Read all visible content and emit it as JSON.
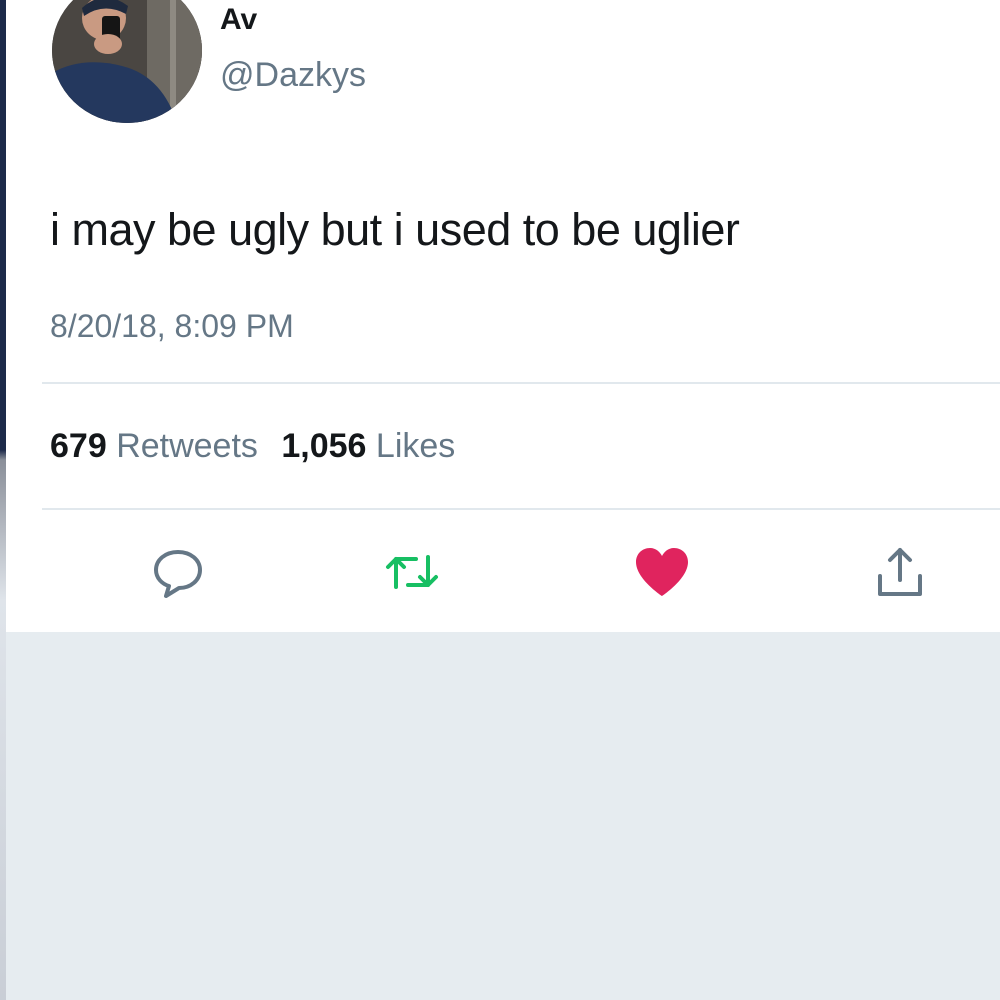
{
  "tweet": {
    "display_name": "Av",
    "handle": "@Dazkys",
    "text": "i may be ugly but i used to be uglier",
    "timestamp": "8/20/18, 8:09 PM",
    "stats": {
      "retweets_count": "679",
      "retweets_label": "Retweets",
      "likes_count": "1,056",
      "likes_label": "Likes"
    },
    "liked": true
  },
  "actions": [
    {
      "name": "reply",
      "icon": "speech-bubble-icon",
      "color": "#657786"
    },
    {
      "name": "retweet",
      "icon": "retweet-arrows-icon",
      "color": "#17bf63"
    },
    {
      "name": "like",
      "icon": "heart-icon",
      "color": "#e0245e"
    },
    {
      "name": "share",
      "icon": "share-upload-icon",
      "color": "#657786"
    }
  ],
  "colors": {
    "text_primary": "#14171a",
    "text_secondary": "#657786",
    "divider": "#e1e8ed",
    "page_background": "#e6ecf0",
    "like_red": "#e0245e",
    "retweet_green": "#17bf63"
  }
}
